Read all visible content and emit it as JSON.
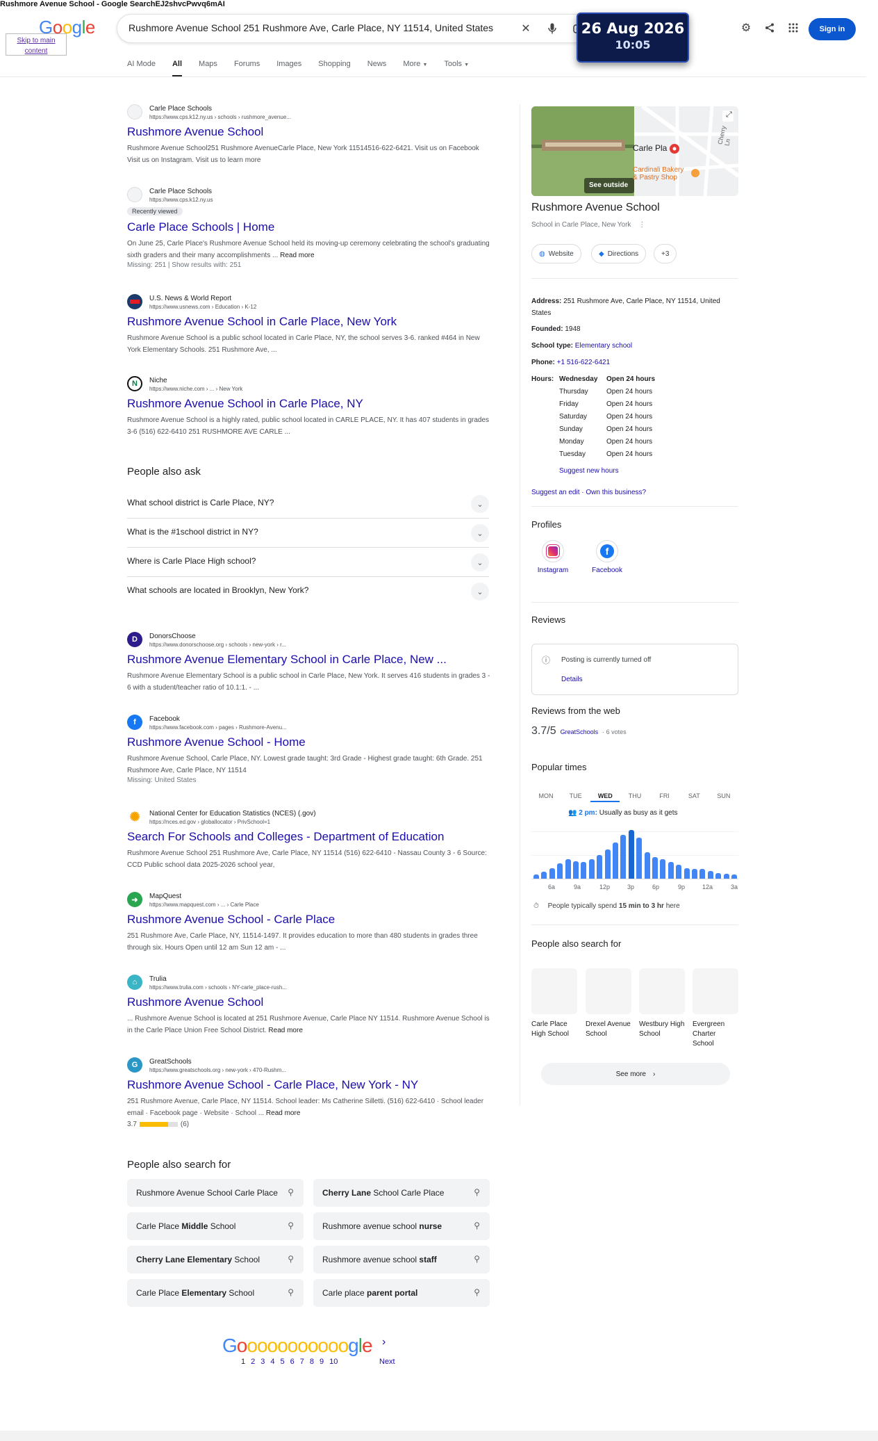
{
  "window": {
    "top_crumb": "Rushmore Avenue School - Google SearchEJ2shvcPwvq6mAI"
  },
  "header": {
    "skip_links": "Skip to main content",
    "logo_letters": [
      "G",
      "o",
      "o",
      "g",
      "l",
      "e"
    ],
    "query": "Rushmore Avenue School 251 Rushmore Ave, Carle Place, NY 11514, United States",
    "signin_label": "Sign in",
    "tabs": [
      "AI Mode",
      "All",
      "Maps",
      "Forums",
      "Images",
      "Shopping",
      "News",
      "More",
      "Tools"
    ],
    "icons": [
      "close-icon",
      "mic-icon",
      "lens-icon",
      "settings-icon",
      "share-icon",
      "apps-icon"
    ]
  },
  "clock": {
    "date": "26 Aug 2026",
    "time": "10:05"
  },
  "results": [
    {
      "site": "Carle Place Schools",
      "url": "https://www.cps.k12.ny.us › schools › rushmore_avenue...",
      "title": "Rushmore Avenue School",
      "snippet": "Rushmore Avenue School251 Rushmore AvenueCarle Place, New York 11514516-622-6421. Visit us on Facebook Visit us on Instagram. Visit us to learn more",
      "badge": "",
      "missing": ""
    },
    {
      "site": "Carle Place Schools",
      "url": "https://www.cps.k12.ny.us",
      "title": "Carle Place Schools | Home",
      "snippet": "On June 25, Carle Place's Rushmore Avenue School held its moving-up ceremony celebrating the school's graduating sixth graders and their many accomplishments ...",
      "read_more": "Read more",
      "badge": "Recently viewed",
      "missing": "Missing: 251 | Show results with: 251"
    },
    {
      "site": "U.S. News & World Report",
      "url": "https://www.usnews.com › Education › K-12",
      "title": "Rushmore Avenue School in Carle Place, New York",
      "snippet": "Rushmore Avenue School is a public school located in Carle Place, NY, the school serves 3-6. ranked #464 in New York Elementary Schools. 251 Rushmore Ave, ...",
      "badge": "",
      "missing": ""
    },
    {
      "site": "Niche",
      "url": "https://www.niche.com › ... › New York",
      "title": "Rushmore Avenue School in Carle Place, NY",
      "snippet": "Rushmore Avenue School is a highly rated, public school located in CARLE PLACE, NY. It has 407 students in grades 3-6 (516) 622-6410 251 RUSHMORE AVE CARLE ...",
      "badge": "",
      "missing": ""
    },
    {
      "site": "DonorsChoose",
      "url": "https://www.donorschoose.org › schools › new-york › r...",
      "title": "Rushmore Avenue Elementary School in Carle Place, New ...",
      "snippet": "Rushmore Avenue Elementary School is a public school in Carle Place, New York. It serves 416 students in grades 3 - 6 with a student/teacher ratio of 10.1:1. - ...",
      "badge": "",
      "missing": ""
    },
    {
      "site": "Facebook",
      "url": "https://www.facebook.com › pages › Rushmore-Avenu...",
      "title": "Rushmore Avenue School - Home",
      "snippet": "Rushmore Avenue School, Carle Place, NY. Lowest grade taught: 3rd Grade - Highest grade taught: 6th Grade. 251 Rushmore Ave, Carle Place, NY 11514",
      "badge": "",
      "missing": "Missing: United States"
    },
    {
      "site": "National Center for Education Statistics (NCES) (.gov)",
      "url": "https://nces.ed.gov › globallocator › PrivSchool=1",
      "title": "Search For Schools and Colleges - Department of Education",
      "snippet": "Rushmore Avenue School 251 Rushmore Ave, Carle Place, NY 11514 (516) 622-6410 - Nassau County 3 - 6 Source: CCD Public school data 2025-2026 school year,",
      "badge": "",
      "missing": ""
    },
    {
      "site": "MapQuest",
      "url": "https://www.mapquest.com › ... › Carle Place",
      "title": "Rushmore Avenue School - Carle Place",
      "snippet": "251 Rushmore Ave, Carle Place, NY, 11514-1497. It provides education to more than 480 students in grades three through six. Hours Open until 12 am Sun 12 am - ...",
      "badge": "",
      "missing": ""
    },
    {
      "site": "Trulia",
      "url": "https://www.trulia.com › schools › NY-carle_place-rush...",
      "title": "Rushmore Avenue School",
      "snippet": "... Rushmore Avenue School is located at 251 Rushmore Avenue, Carle Place NY 11514. Rushmore Avenue School is in the Carle Place Union Free School District.",
      "read_more": "Read more",
      "badge": "",
      "missing": ""
    },
    {
      "site": "GreatSchools",
      "url": "https://www.greatschools.org › new-york › 470-Rushm...",
      "title": "Rushmore Avenue School - Carle Place, New York - NY",
      "snippet": "251 Rushmore Avenue, Carle Place, NY 11514. School leader: Ms Catherine Silletti. (516) 622-6410 · School leader email · Facebook page · Website · School ...",
      "read_more": "Read more",
      "rating": "3.7",
      "rating_count": "(6)",
      "rating_fraction": 0.74,
      "badge": "",
      "missing": ""
    }
  ],
  "paa": {
    "title": "People also ask",
    "questions": [
      "What school district is Carle Place, NY?",
      "What is the #1school district in NY?",
      "Where is Carle Place High school?",
      "What schools are located in Brooklyn, New York?"
    ]
  },
  "kp": {
    "title": "Rushmore Avenue School",
    "subtitle": "School in Carle Place, New York",
    "map_label": "Carle Pla",
    "map_poi": "Cardinali Bakery & Pastry Shop",
    "map_street": "Cherry Ln",
    "see_outside": "See outside",
    "chips": [
      "Website",
      "Directions",
      "+3"
    ],
    "address_label": "Address:",
    "address": "251 Rushmore Ave, Carle Place, NY 11514, United States",
    "founded_label": "Founded:",
    "founded": "1948",
    "type_label": "School type:",
    "type": "Elementary school",
    "phone_label": "Phone:",
    "phone": "+1 516-622-6421",
    "hours_label": "Hours:",
    "hours": [
      {
        "day": "Wednesday",
        "val": "Open 24 hours"
      },
      {
        "day": "Thursday",
        "val": "Open 24 hours"
      },
      {
        "day": "Friday",
        "val": "Open 24 hours"
      },
      {
        "day": "Saturday",
        "val": "Open 24 hours"
      },
      {
        "day": "Sunday",
        "val": "Open 24 hours"
      },
      {
        "day": "Monday",
        "val": "Open 24 hours"
      },
      {
        "day": "Tuesday",
        "val": "Open 24 hours"
      }
    ],
    "suggest_hours": "Suggest new hours",
    "suggest_edit": "Suggest an edit",
    "own_business": "Own this business?",
    "profiles_title": "Profiles",
    "profiles": [
      "Instagram",
      "Facebook"
    ],
    "reviews_title": "Reviews",
    "posting_off": "Posting is currently turned off",
    "details": "Details",
    "web_reviews_title": "Reviews from the web",
    "web_score": "3.7/5",
    "web_source": "GreatSchools",
    "web_votes": "· 6 votes",
    "popular_title": "Popular times",
    "days": [
      "MON",
      "TUE",
      "WED",
      "THU",
      "FRI",
      "SAT",
      "SUN"
    ],
    "busy_time": "2 pm:",
    "busy_text": "Usually as busy as it gets",
    "hour_labels": [
      "6a",
      "9a",
      "12p",
      "3p",
      "6p",
      "9p",
      "12a",
      "3a"
    ],
    "busyness": [
      0.08,
      0.14,
      0.22,
      0.32,
      0.4,
      0.36,
      0.35,
      0.4,
      0.48,
      0.6,
      0.75,
      0.9,
      1.0,
      0.85,
      0.55,
      0.45,
      0.4,
      0.34,
      0.28,
      0.22,
      0.2,
      0.2,
      0.16,
      0.12,
      0.1,
      0.08
    ],
    "spend_text": "People typically spend",
    "spend_bold": "15 min to 3 hr",
    "spend_tail": "here",
    "also_search_title": "People also search for",
    "also_search": [
      "Carle Place High School",
      "Drexel Avenue School",
      "Westbury High School",
      "Evergreen Charter School"
    ],
    "see_more": "See more"
  },
  "pasf": {
    "title": "People also search for",
    "items": [
      {
        "pre": "Rushmore Avenue School Carle Place",
        "bold": "",
        "post": ""
      },
      {
        "pre": "",
        "bold": "Cherry Lane",
        "post": " School Carle Place"
      },
      {
        "pre": "Carle Place ",
        "bold": "Middle",
        "post": " School"
      },
      {
        "pre": "Rushmore avenue school ",
        "bold": "nurse",
        "post": ""
      },
      {
        "pre": "",
        "bold": "Cherry Lane Elementary",
        "post": " School"
      },
      {
        "pre": "Rushmore avenue school ",
        "bold": "staff",
        "post": ""
      },
      {
        "pre": "Carle Place ",
        "bold": "Elementary",
        "post": " School"
      },
      {
        "pre": "Carle place ",
        "bold": "parent portal",
        "post": ""
      }
    ]
  },
  "pager": {
    "logo": "Gooooooooooogle",
    "pages": [
      "1",
      "2",
      "3",
      "4",
      "5",
      "6",
      "7",
      "8",
      "9",
      "10"
    ],
    "next": "Next"
  },
  "colors": {
    "link": "#1a0dab",
    "brand_blue": "#0b57d0",
    "bar_blue": "#4285f4",
    "rating_yellow": "#fbbc04"
  }
}
